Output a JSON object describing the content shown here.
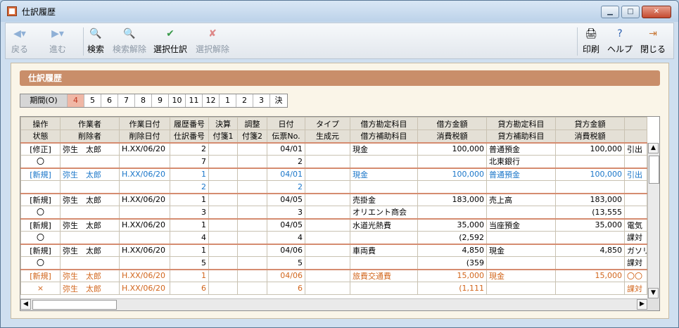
{
  "window": {
    "title": "仕訳履歴"
  },
  "toolbar": {
    "back": "戻る",
    "forward": "進む",
    "search": "検索",
    "clear_search": "検索解除",
    "select_entry": "選択仕訳",
    "deselect": "選択解除",
    "print": "印刷",
    "help": "ヘルプ",
    "close": "閉じる"
  },
  "section_title": "仕訳履歴",
  "periods": {
    "label": "期間(O)",
    "items": [
      "4",
      "5",
      "6",
      "7",
      "8",
      "9",
      "10",
      "11",
      "12",
      "1",
      "2",
      "3",
      "決"
    ],
    "active": "4"
  },
  "grid": {
    "header1": [
      "操作",
      "作業者",
      "作業日付",
      "履歴番号",
      "決算",
      "調整",
      "日付",
      "タイプ",
      "借方勘定科目",
      "借方金額",
      "貸方勘定科目",
      "貸方金額",
      ""
    ],
    "header2": [
      "状態",
      "削除者",
      "削除日付",
      "仕訳番号",
      "付箋1",
      "付箋2",
      "伝票No.",
      "生成元",
      "借方補助科目",
      "消費税額",
      "貸方補助科目",
      "消費税額",
      ""
    ],
    "rows": [
      {
        "style": "",
        "grp": true,
        "cells": [
          "[修正]",
          "弥生　太郎",
          "H.XX/06/20",
          "2",
          "",
          "",
          "04/01",
          "",
          "現金",
          "100,000",
          "普通預金",
          "100,000",
          "引出"
        ]
      },
      {
        "style": "",
        "grp": false,
        "cells": [
          "〇",
          "",
          "",
          "7",
          "",
          "",
          "2",
          "",
          "",
          "",
          "北東銀行",
          "",
          ""
        ]
      },
      {
        "style": "blue",
        "grp": true,
        "cells": [
          "[新規]",
          "弥生　太郎",
          "H.XX/06/20",
          "1",
          "",
          "",
          "04/01",
          "",
          "現金",
          "100,000",
          "普通預金",
          "100,000",
          "引出"
        ]
      },
      {
        "style": "blue",
        "grp": false,
        "cells": [
          "",
          "",
          "",
          "2",
          "",
          "",
          "2",
          "",
          "",
          "",
          "",
          "",
          ""
        ]
      },
      {
        "style": "",
        "grp": true,
        "cells": [
          "[新規]",
          "弥生　太郎",
          "H.XX/06/20",
          "1",
          "",
          "",
          "04/05",
          "",
          "売掛金",
          "183,000",
          "売上高",
          "183,000",
          ""
        ]
      },
      {
        "style": "",
        "grp": false,
        "cells": [
          "〇",
          "",
          "",
          "3",
          "",
          "",
          "3",
          "",
          "オリエント商会",
          "",
          "",
          "(13,555",
          ""
        ]
      },
      {
        "style": "",
        "grp": true,
        "cells": [
          "[新規]",
          "弥生　太郎",
          "H.XX/06/20",
          "1",
          "",
          "",
          "04/05",
          "",
          "水道光熱費",
          "35,000",
          "当座預金",
          "35,000",
          "電気"
        ]
      },
      {
        "style": "",
        "grp": false,
        "cells": [
          "〇",
          "",
          "",
          "4",
          "",
          "",
          "4",
          "",
          "",
          "(2,592",
          "",
          "",
          "課対"
        ]
      },
      {
        "style": "",
        "grp": true,
        "cells": [
          "[新規]",
          "弥生　太郎",
          "H.XX/06/20",
          "1",
          "",
          "",
          "04/06",
          "",
          "車両費",
          "4,850",
          "現金",
          "4,850",
          "ガソリ"
        ]
      },
      {
        "style": "",
        "grp": false,
        "cells": [
          "〇",
          "",
          "",
          "5",
          "",
          "",
          "5",
          "",
          "",
          "(359",
          "",
          "",
          "課対"
        ]
      },
      {
        "style": "orange",
        "grp": true,
        "cells": [
          "[新規]",
          "弥生　太郎",
          "H.XX/06/20",
          "1",
          "",
          "",
          "04/06",
          "",
          "旅費交通費",
          "15,000",
          "現金",
          "15,000",
          "〇〇"
        ]
      },
      {
        "style": "orange",
        "grp": false,
        "cells": [
          "×",
          "弥生　太郎",
          "H.XX/06/20",
          "6",
          "",
          "",
          "6",
          "",
          "",
          "(1,111",
          "",
          "",
          "課対"
        ]
      }
    ]
  }
}
